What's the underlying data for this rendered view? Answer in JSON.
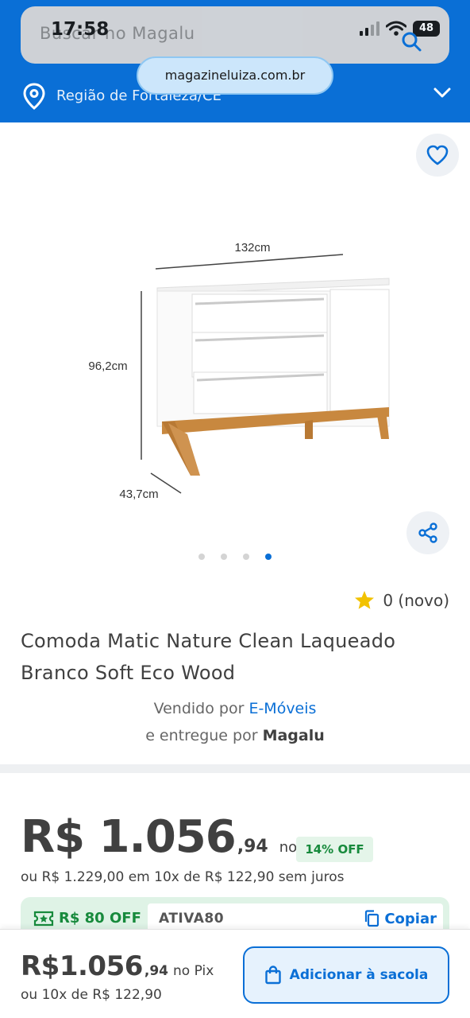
{
  "status_bar": {
    "time": "17:58",
    "battery": "48"
  },
  "header": {
    "search_placeholder": "Buscar no Magalu",
    "url": "magazineluiza.com.br",
    "region": "Região de Fortaleza/CE"
  },
  "product": {
    "image": {
      "dim_width": "132cm",
      "dim_height": "96,2cm",
      "dim_depth": "43,7cm"
    },
    "carousel": {
      "total": 4,
      "active_index": 3
    },
    "rating": "0 (novo)",
    "title": "Comoda Matic Nature Clean Laqueado Branco Soft Eco Wood",
    "seller": {
      "sold_by_prefix": "Vendido por",
      "sold_by": "E-Móveis",
      "delivered_by_prefix": "e entregue por",
      "delivered_by": "Magalu"
    }
  },
  "price": {
    "main": "R$ 1.056",
    "cents": ",94",
    "pix_label": "no Pix",
    "off_badge": "14% OFF",
    "installments": "ou R$ 1.229,00 em 10x de R$ 122,90 sem juros"
  },
  "coupon": {
    "off_label": "R$ 80 OFF",
    "code": "ATIVA80",
    "copy_label": "Copiar"
  },
  "bottom_bar": {
    "price_main": "R$1.056",
    "price_cents": ",94",
    "pix_label": "no Pix",
    "installments": "ou 10x de R$ 122,90",
    "add_button": "Adicionar à sacola"
  },
  "colors": {
    "brand_blue": "#0a6fd6",
    "green": "#178a3c",
    "star": "#f2c200"
  }
}
